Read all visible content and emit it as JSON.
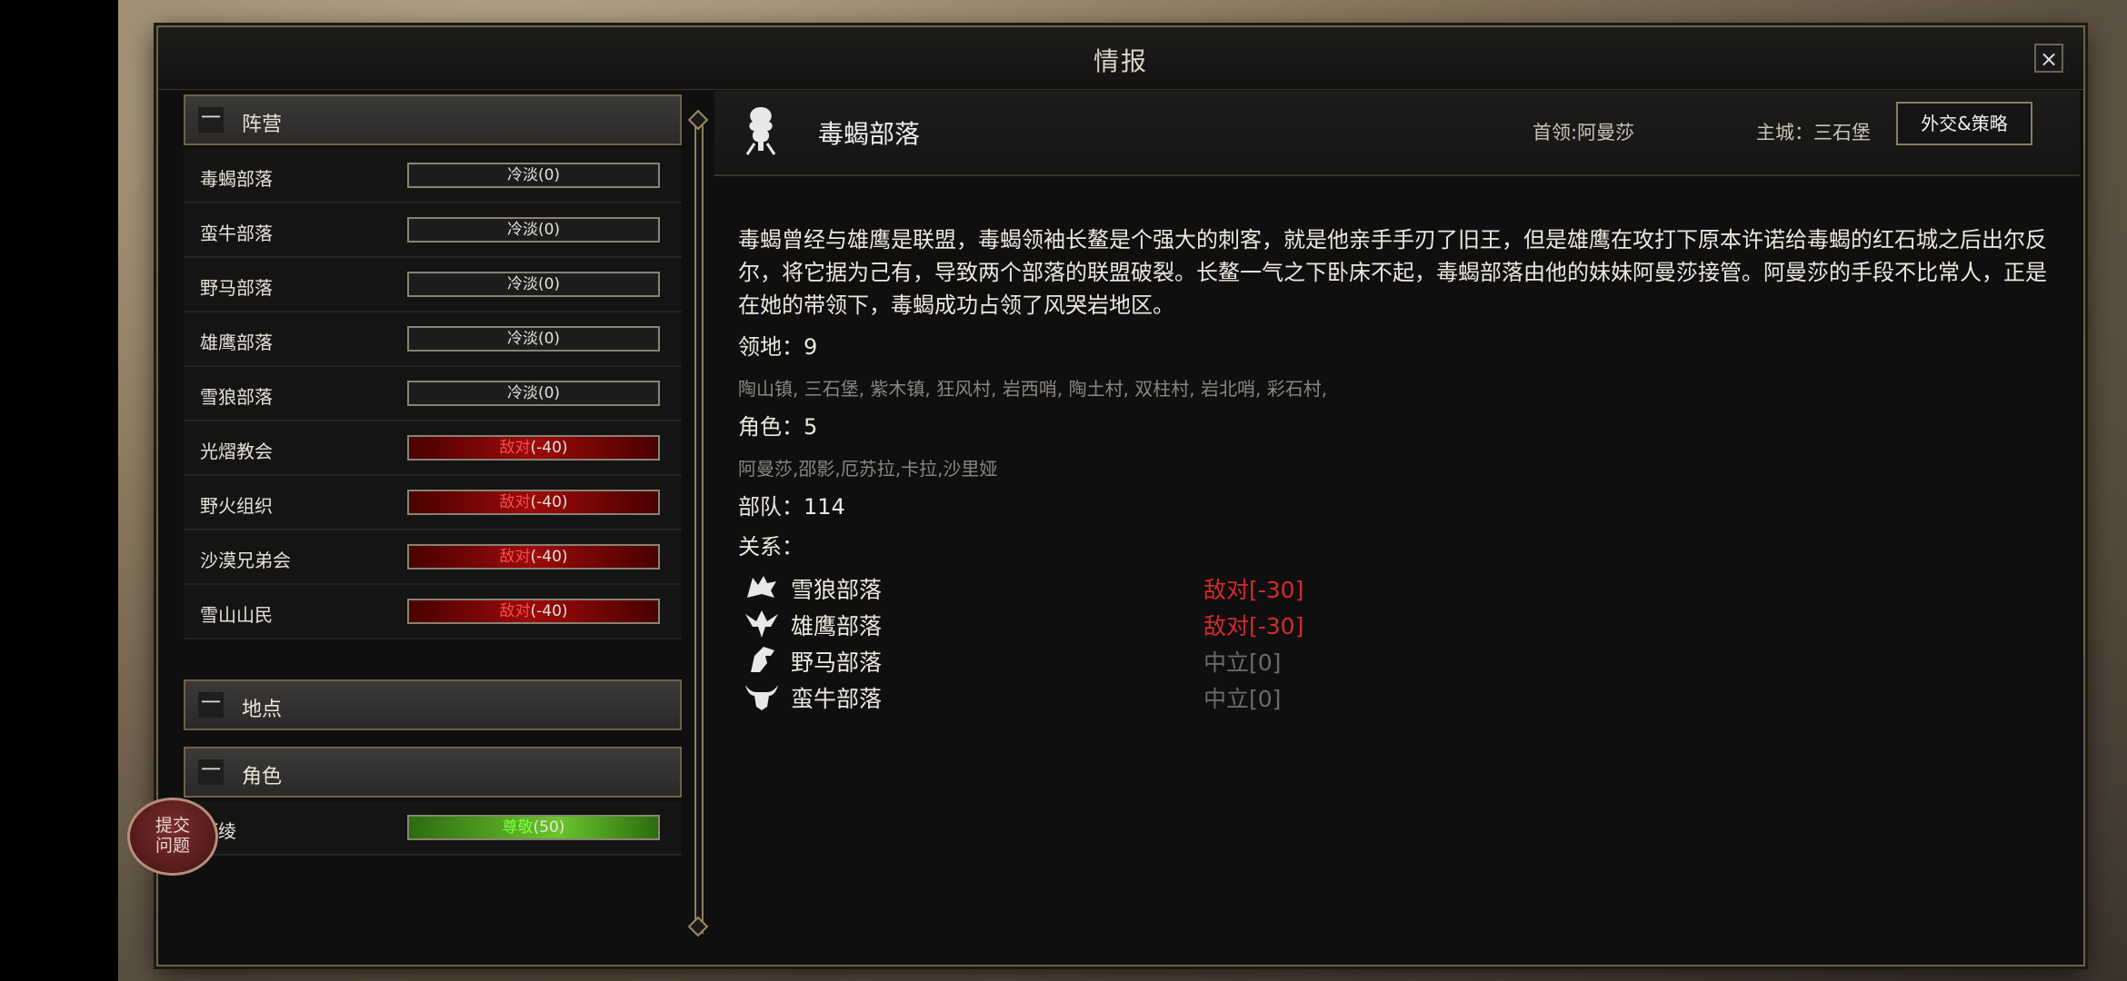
{
  "window": {
    "title": "情报",
    "close_label": "×"
  },
  "help_button": {
    "line1": "提交",
    "line2": "问题"
  },
  "sidebar": {
    "sections": {
      "factions": {
        "label": "阵营",
        "toggle": "一"
      },
      "places": {
        "label": "地点",
        "toggle": "一"
      },
      "characters": {
        "label": "角色",
        "toggle": "一"
      }
    },
    "factions": [
      {
        "name": "毒蝎部落",
        "status": "冷淡",
        "value": "(0)",
        "kind": "neutral"
      },
      {
        "name": "蛮牛部落",
        "status": "冷淡",
        "value": "(0)",
        "kind": "neutral"
      },
      {
        "name": "野马部落",
        "status": "冷淡",
        "value": "(0)",
        "kind": "neutral"
      },
      {
        "name": "雄鹰部落",
        "status": "冷淡",
        "value": "(0)",
        "kind": "neutral"
      },
      {
        "name": "雪狼部落",
        "status": "冷淡",
        "value": "(0)",
        "kind": "neutral"
      },
      {
        "name": "光熠教会",
        "status": "敌对",
        "value": "(-40)",
        "kind": "hostile"
      },
      {
        "name": "野火组织",
        "status": "敌对",
        "value": "(-40)",
        "kind": "hostile"
      },
      {
        "name": "沙漠兄弟会",
        "status": "敌对",
        "value": "(-40)",
        "kind": "hostile"
      },
      {
        "name": "雪山山民",
        "status": "敌对",
        "value": "(-40)",
        "kind": "hostile"
      }
    ],
    "characters": [
      {
        "name": "阿绫",
        "status": "尊敬",
        "value": "(50)",
        "kind": "friendly"
      }
    ]
  },
  "detail": {
    "faction_icon": "scorpion-icon",
    "faction_name": "毒蝎部落",
    "leader_text": "首领:阿曼莎",
    "city_text": "主城：三石堡",
    "diplomacy_button": "外交&策略",
    "description": "毒蝎曾经与雄鹰是联盟，毒蝎领袖长鳌是个强大的刺客，就是他亲手手刃了旧王，但是雄鹰在攻打下原本许诺给毒蝎的红石城之后出尔反尔，将它据为己有，导致两个部落的联盟破裂。长鳌一气之下卧床不起，毒蝎部落由他的妹妹阿曼莎接管。阿曼莎的手段不比常人，正是在她的带领下，毒蝎成功占领了风哭岩地区。",
    "territory_label": "领地：9",
    "territory_list": "陶山镇, 三石堡, 紫木镇, 狂风村, 岩西哨, 陶土村, 双柱村, 岩北哨, 彩石村,",
    "roles_label": "角色：5",
    "roles_list": "阿曼莎,邵影,厄苏拉,卡拉,沙里娅",
    "troops_label": "部队：114",
    "relations_label": "关系：",
    "relations": [
      {
        "icon": "wolf-icon",
        "name": "雪狼部落",
        "status": "敌对[-30]",
        "kind": "hostile"
      },
      {
        "icon": "eagle-icon",
        "name": "雄鹰部落",
        "status": "敌对[-30]",
        "kind": "hostile"
      },
      {
        "icon": "horse-icon",
        "name": "野马部落",
        "status": "中立[0]",
        "kind": "neutral"
      },
      {
        "icon": "bull-icon",
        "name": "蛮牛部落",
        "status": "中立[0]",
        "kind": "neutral"
      }
    ]
  },
  "colors": {
    "hostile": "#d62a2a",
    "neutral": "#6c6a66",
    "friendly_bar": "#6bc52c",
    "frame_gold": "#8c7d5c"
  }
}
